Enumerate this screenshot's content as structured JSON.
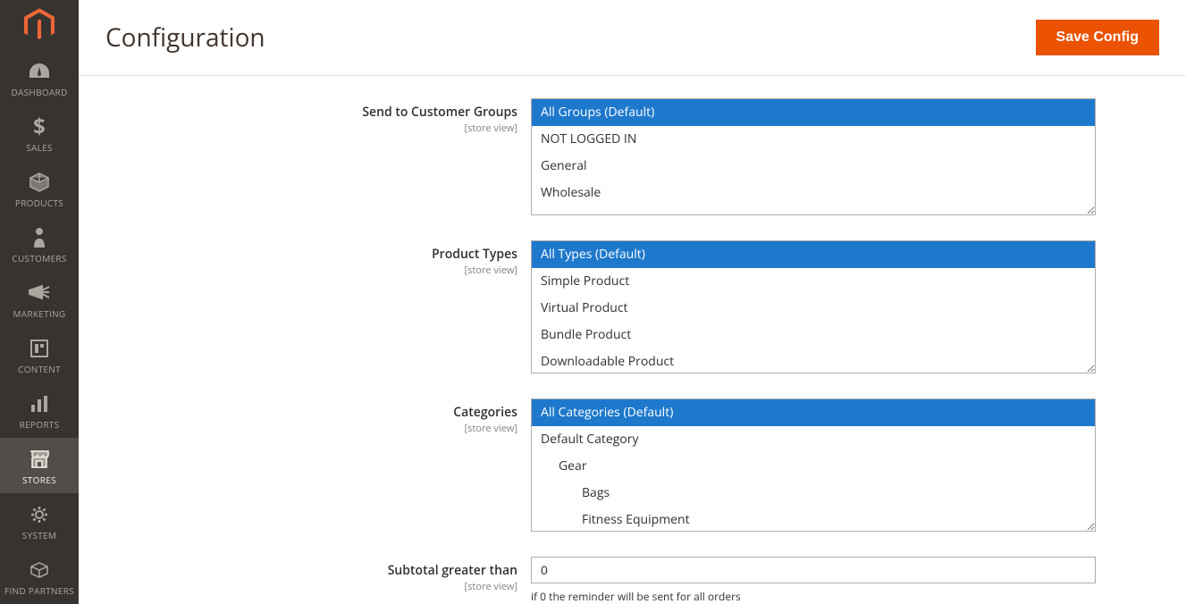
{
  "sidebar": {
    "items": [
      {
        "label": "DASHBOARD"
      },
      {
        "label": "SALES"
      },
      {
        "label": "PRODUCTS"
      },
      {
        "label": "CUSTOMERS"
      },
      {
        "label": "MARKETING"
      },
      {
        "label": "CONTENT"
      },
      {
        "label": "REPORTS"
      },
      {
        "label": "STORES"
      },
      {
        "label": "SYSTEM"
      },
      {
        "label": "FIND PARTNERS"
      }
    ]
  },
  "header": {
    "title": "Configuration",
    "save_label": "Save Config"
  },
  "fields": {
    "customer_groups": {
      "label": "Send to Customer Groups",
      "scope": "[store view]",
      "options": [
        "All Groups (Default)",
        "NOT LOGGED IN",
        "General",
        "Wholesale"
      ]
    },
    "product_types": {
      "label": "Product Types",
      "scope": "[store view]",
      "options": [
        "All Types (Default)",
        "Simple Product",
        "Virtual Product",
        "Bundle Product",
        "Downloadable Product"
      ]
    },
    "categories": {
      "label": "Categories",
      "scope": "[store view]",
      "options": [
        "All Categories (Default)",
        "Default Category",
        "Gear",
        "Bags",
        "Fitness Equipment"
      ]
    },
    "subtotal": {
      "label": "Subtotal greater than",
      "scope": "[store view]",
      "value": "0",
      "note": "if 0 the reminder will be sent for all orders"
    }
  }
}
